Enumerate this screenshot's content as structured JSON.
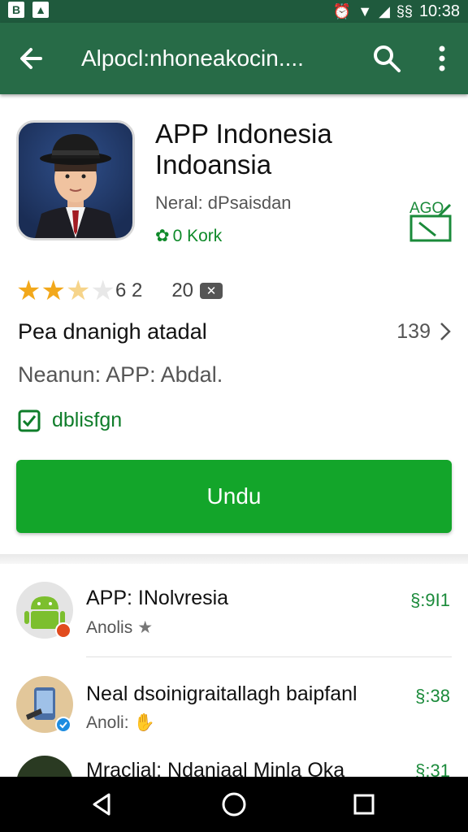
{
  "status_bar": {
    "left_icons": [
      "B",
      "▲"
    ],
    "right_text": "10:38",
    "extra": "§§"
  },
  "app_bar": {
    "title": "Alpocl:nhoneakocin....",
    "icons": [
      "back-arrow-icon",
      "search-icon",
      "more-vert-icon"
    ]
  },
  "app": {
    "title_line1": "APP Indonesia",
    "title_line2": "Indoansia",
    "developer": "Neral: dPsaisdan",
    "editor_label": "0 Kork",
    "age_badge_label": "AGO",
    "rating_value": "6 2",
    "rating_count": "20",
    "rating_stars": 2.5,
    "description_label": "Pea dnanigh atadal",
    "description_count": "139",
    "requirement_text": "Neanun: APP: Abdal.",
    "verified_label": "dblisfgn",
    "install_label": "Undu"
  },
  "related": [
    {
      "title": "APP: INolvresia",
      "subtitle": "Anolis",
      "price": "§:9I1",
      "icon": "android-icon"
    },
    {
      "title": "Neal dsoinigraitallagh baipfanl",
      "subtitle": "Anoli:",
      "price": "§:38",
      "icon": "phone-app-icon"
    },
    {
      "title": "Mraclial: Ndaniaal Minla Oka",
      "subtitle": "",
      "price": "§:31",
      "icon": "circle-app-icon"
    }
  ],
  "colors": {
    "status_bar": "#1f5a3d",
    "app_bar": "#276b47",
    "install_button": "#13a52a",
    "accent_green": "#0f8a2a",
    "star": "#f2a81b"
  }
}
